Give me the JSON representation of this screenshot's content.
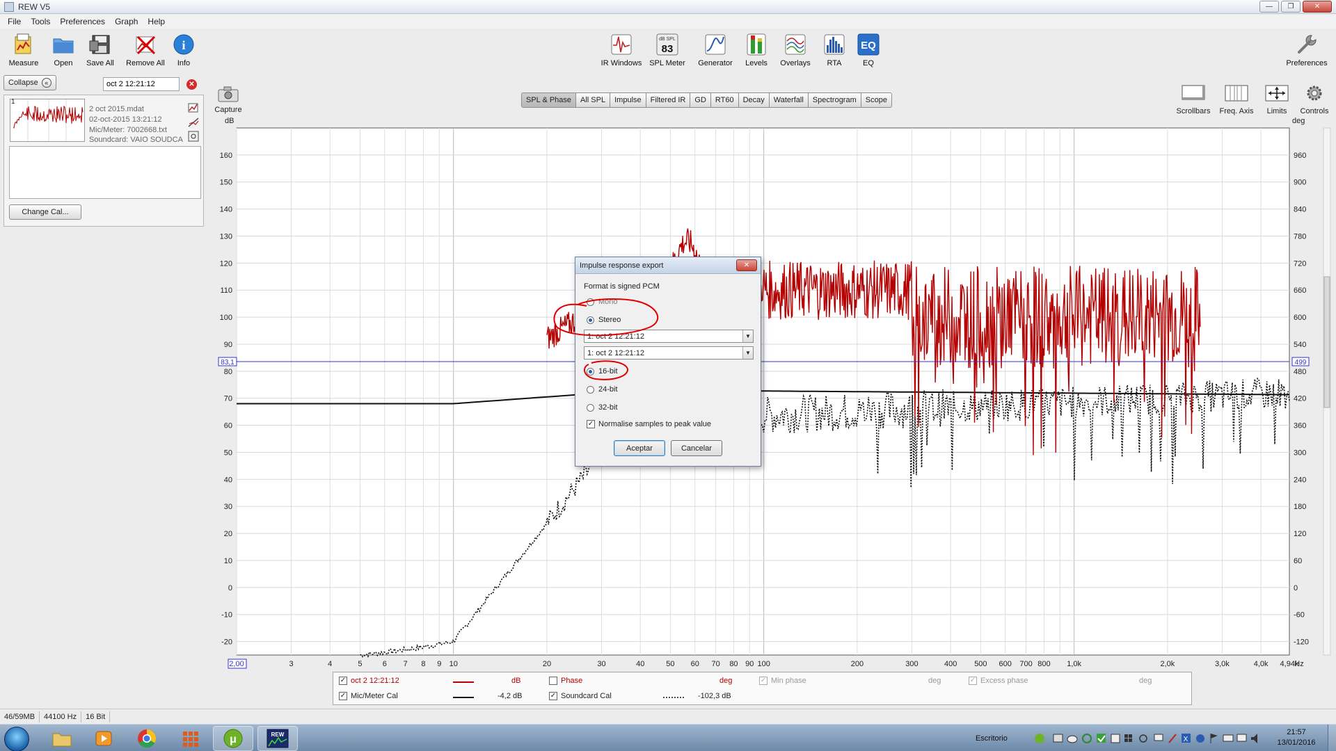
{
  "window": {
    "title": "REW V5"
  },
  "menu": [
    "File",
    "Tools",
    "Preferences",
    "Graph",
    "Help"
  ],
  "toolbar": {
    "measure": "Measure",
    "open": "Open",
    "save_all": "Save All",
    "remove_all": "Remove All",
    "info": "Info",
    "ir_windows": "IR Windows",
    "spl_meter": "SPL Meter",
    "spl_badge_unit": "dB SPL",
    "spl_badge_value": "83",
    "generator": "Generator",
    "levels": "Levels",
    "overlays": "Overlays",
    "rta": "RTA",
    "eq": "EQ",
    "eq_badge": "EQ",
    "preferences": "Preferences"
  },
  "left_panel": {
    "collapse": "Collapse",
    "measurement_name": "oct 2 12:21:12",
    "index": "1",
    "file": "2 oct 2015.mdat",
    "date": "02-oct-2015 13:21:12",
    "mic": "Mic/Meter: 7002668.txt",
    "soundcard": "Soundcard: VAIO SOUDCA",
    "change_cal": "Change Cal..."
  },
  "capture": "Capture",
  "graph_tabs": [
    "SPL & Phase",
    "All SPL",
    "Impulse",
    "Filtered IR",
    "GD",
    "RT60",
    "Decay",
    "Waterfall",
    "Spectrogram",
    "Scope"
  ],
  "right_tools": {
    "scrollbars": "Scrollbars",
    "freq_axis": "Freq. Axis",
    "limits": "Limits",
    "controls": "Controls"
  },
  "graph": {
    "left_unit": "dB",
    "right_unit": "deg",
    "y_ticks": [
      "160",
      "150",
      "140",
      "130",
      "120",
      "110",
      "100",
      "90",
      "80",
      "70",
      "60",
      "50",
      "40",
      "30",
      "20",
      "10",
      "0",
      "-10",
      "-20"
    ],
    "deg_ticks": [
      "960",
      "900",
      "840",
      "780",
      "720",
      "660",
      "600",
      "540",
      "480",
      "420",
      "360",
      "300",
      "240",
      "180",
      "120",
      "60",
      "0",
      "-60",
      "-120"
    ],
    "x_ticks": [
      "2,00",
      "3",
      "4",
      "5",
      "6",
      "7",
      "8",
      "9",
      "10",
      "20",
      "30",
      "40",
      "50",
      "60",
      "70",
      "80",
      "90",
      "100",
      "200",
      "300",
      "400",
      "500",
      "600",
      "700",
      "800",
      "1,0k",
      "2,0k",
      "3,0k",
      "4,0k",
      "4,94k",
      "Hz"
    ],
    "cursor_left": "83,1",
    "cursor_right": "499"
  },
  "legend": {
    "m1_name": "oct 2 12:21:12",
    "m1_unit": "dB",
    "phase": "Phase",
    "phase_unit": "deg",
    "min_phase": "Min phase",
    "min_phase_unit": "deg",
    "excess_phase": "Excess phase",
    "excess_phase_unit": "deg",
    "mic_cal": "Mic/Meter Cal",
    "mic_cal_value": "-4,2 dB",
    "sc_cal": "Soundcard Cal",
    "sc_cal_value": "-102,3 dB"
  },
  "status": {
    "memory": "46/59MB",
    "rate": "44100 Hz",
    "bits": "16 Bit"
  },
  "dialog": {
    "title": "Impulse response export",
    "format": "Format is signed PCM",
    "mono": "Mono",
    "stereo": "Stereo",
    "left_channel": "1: oct 2 12:21:12",
    "right_channel": "1: oct 2 12:21:12",
    "bit16": "16-bit",
    "bit24": "24-bit",
    "bit32": "32-bit",
    "normalise": "Normalise samples to peak value",
    "ok": "Aceptar",
    "cancel": "Cancelar"
  },
  "taskbar": {
    "tray_label": "Escritorio",
    "time": "21:57",
    "date": "13/01/2016"
  },
  "colors": {
    "measurement": "#b40000",
    "cal_trace": "#111111",
    "cursor": "#3333cc",
    "annotation": "#e00000"
  }
}
